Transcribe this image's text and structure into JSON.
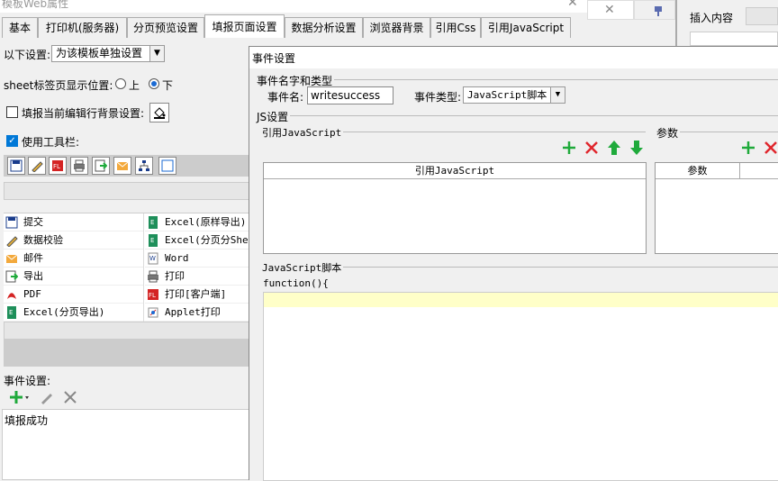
{
  "window": {
    "title": "模板Web属性"
  },
  "tabs": [
    {
      "label": "基本"
    },
    {
      "label": "打印机(服务器)"
    },
    {
      "label": "分页预览设置"
    },
    {
      "label": "填报页面设置"
    },
    {
      "label": "数据分析设置"
    },
    {
      "label": "浏览器背景"
    },
    {
      "label": "引用Css"
    },
    {
      "label": "引用JavaScript"
    }
  ],
  "settings": {
    "scope_label": "以下设置:",
    "scope_value": "为该模板单独设置",
    "sheet_pos_label": "sheet标签页显示位置:",
    "radio_top": "上",
    "radio_bottom": "下",
    "fill_bg_label": "填报当前编辑行背景设置:",
    "use_toolbar_label": "使用工具栏:"
  },
  "button_list": [
    {
      "left": "提交",
      "right": "Excel(原样导出)"
    },
    {
      "left": "数据校验",
      "right": "Excel(分页分Sheet导出)"
    },
    {
      "left": "邮件",
      "right": "Word"
    },
    {
      "left": "导出",
      "right": "打印"
    },
    {
      "left": "PDF",
      "right": "打印[客户端]"
    },
    {
      "left": "Excel(分页导出)",
      "right": "Applet打印"
    }
  ],
  "events": {
    "label": "事件设置:",
    "items": [
      "填报成功"
    ]
  },
  "dialog": {
    "title": "事件设置",
    "group_name_type": "事件名字和类型",
    "event_name_label": "事件名:",
    "event_name_value": "writesuccess",
    "event_type_label": "事件类型:",
    "event_type_value": "JavaScript脚本",
    "js_settings": "JS设置",
    "ref_js_title": "引用JavaScript",
    "ref_js_header": "引用JavaScript",
    "params_title": "参数",
    "params_header": "参数",
    "script_title": "JavaScript脚本",
    "script_code": "function(){"
  },
  "right_panel": {
    "insert_content": "插入内容"
  },
  "colors": {
    "green": "#1faa3b",
    "red": "#e0262d",
    "highlight_line": "#ffffc8"
  }
}
